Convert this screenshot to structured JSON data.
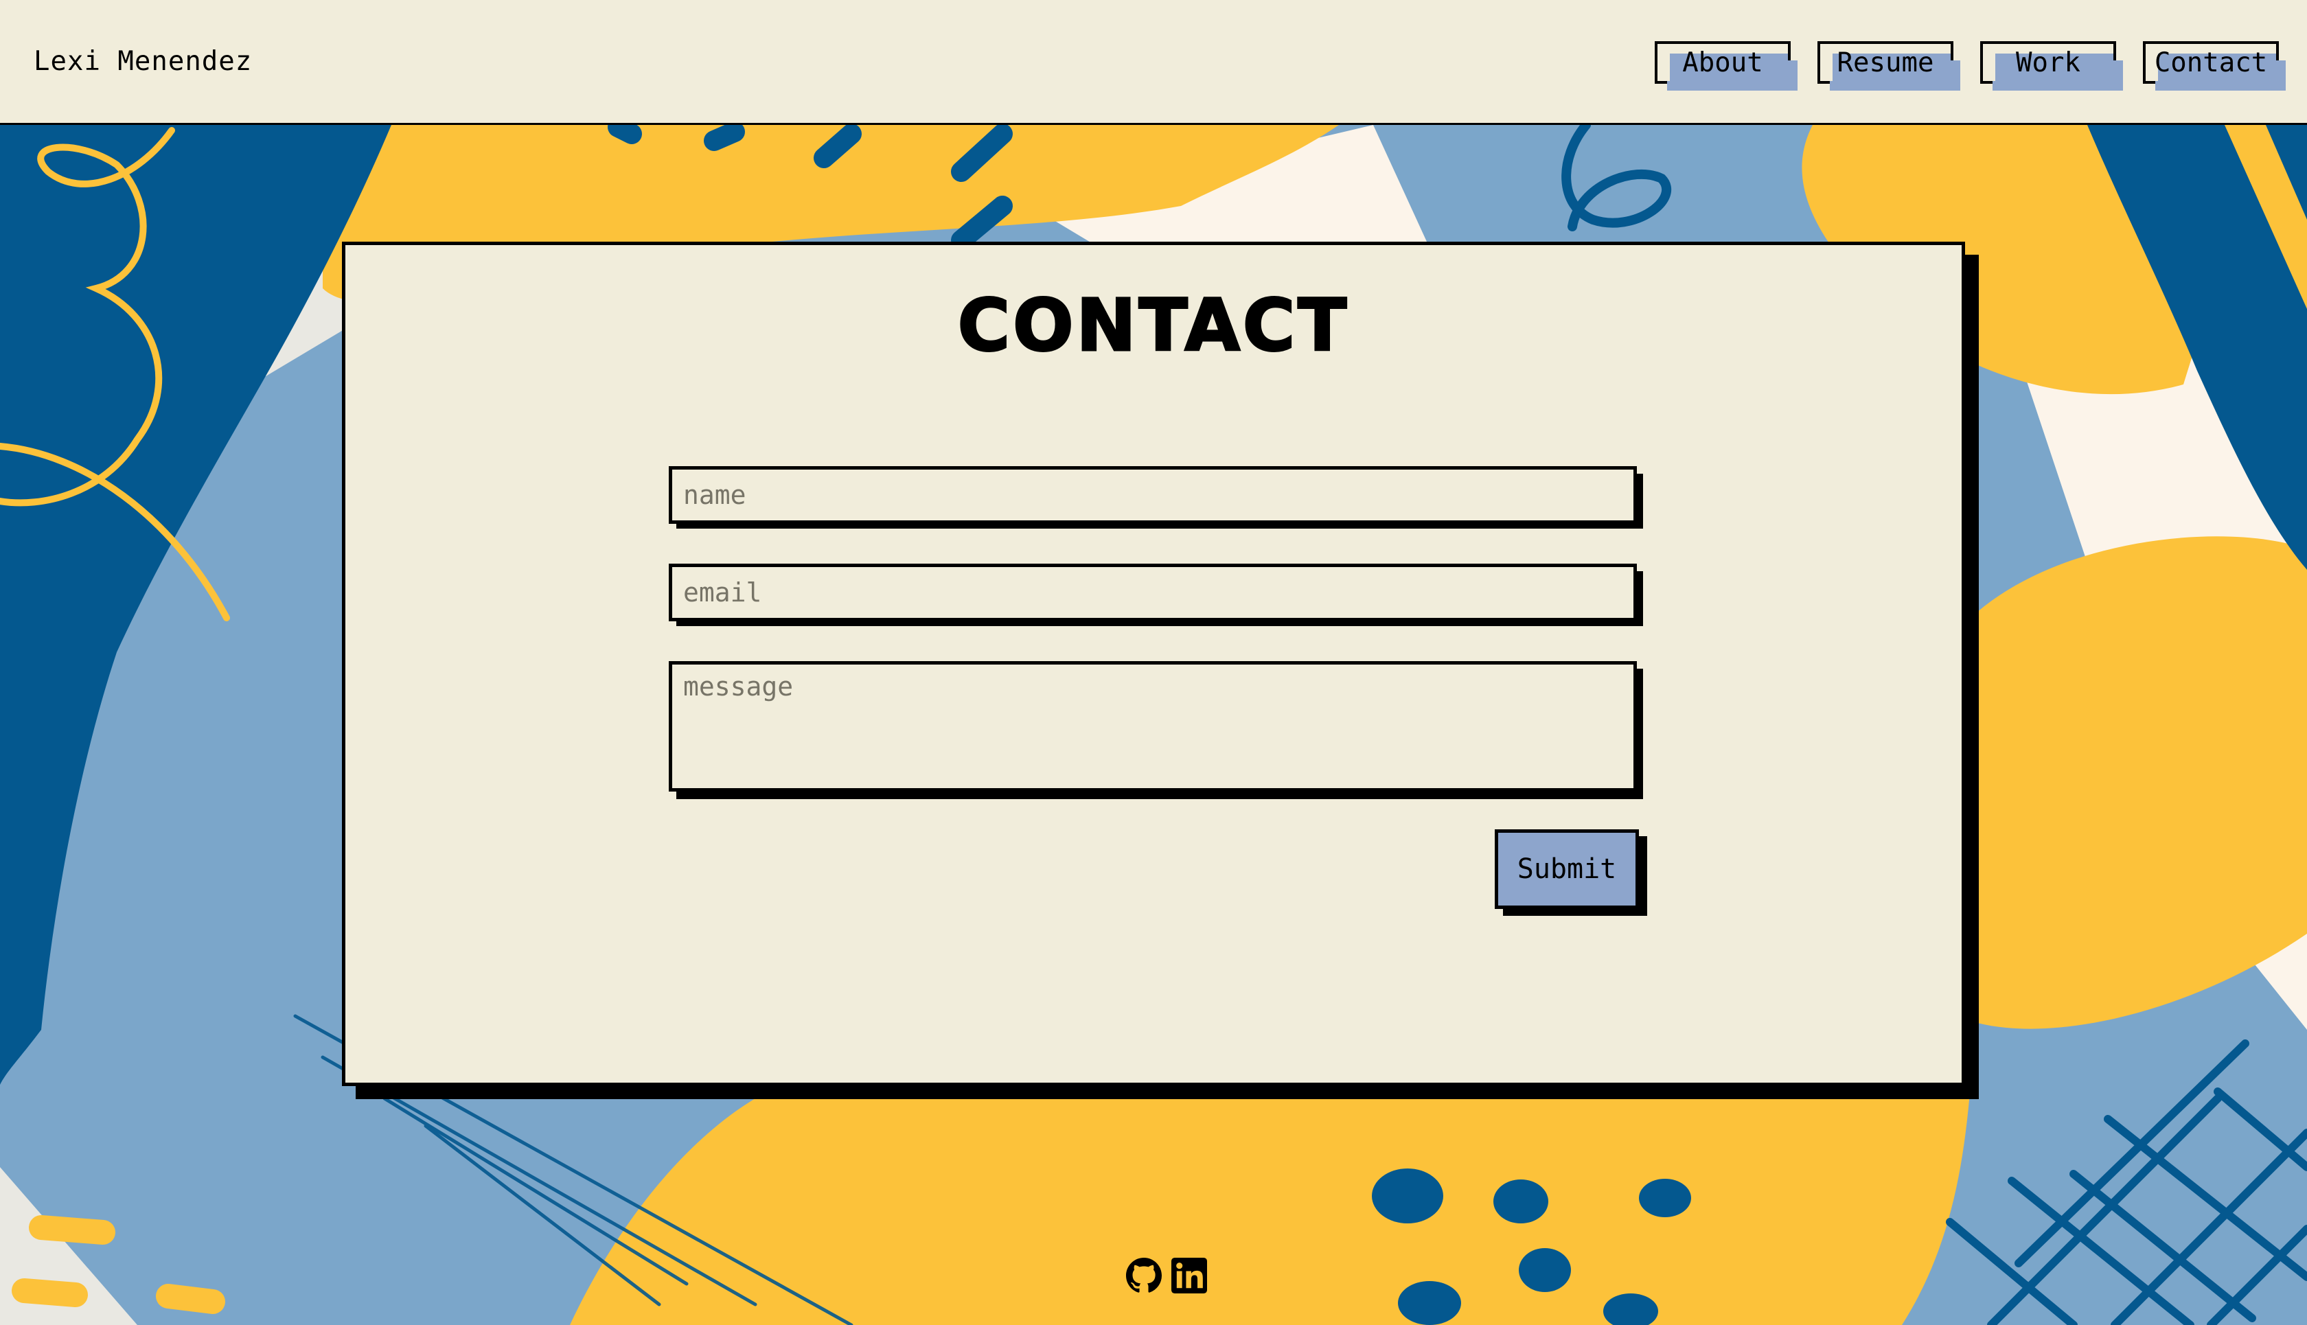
{
  "header": {
    "site_name": "Lexi Menendez",
    "nav": [
      {
        "label": "About"
      },
      {
        "label": "Resume"
      },
      {
        "label": "Work"
      },
      {
        "label": "Contact"
      }
    ]
  },
  "contact": {
    "title": "CONTACT",
    "name_placeholder": "name",
    "email_placeholder": "email",
    "message_placeholder": "message",
    "submit_label": "Submit"
  },
  "footer": {
    "icons": [
      "github-icon",
      "linkedin-icon"
    ]
  },
  "colors": {
    "background": "#f1eddb",
    "accent_blue": "#8da5cc",
    "dark_blue": "#04588f",
    "light_blue": "#7ba6ca",
    "yellow": "#fcc23a",
    "cream": "#fcf4ea"
  }
}
